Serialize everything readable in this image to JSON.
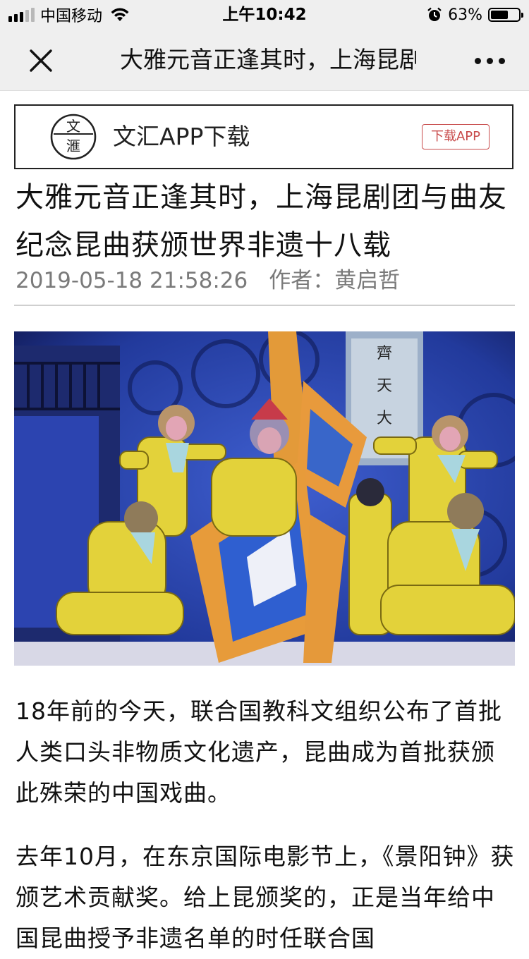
{
  "status_bar": {
    "carrier": "中国移动",
    "time": "上午10:42",
    "battery_percent": "63%",
    "battery_level": 0.63,
    "icons": [
      "signal-icon",
      "wifi-icon",
      "alarm-icon",
      "battery-icon"
    ]
  },
  "nav": {
    "title": "大雅元音正逢其时，上海昆剧",
    "close_icon": "close-icon",
    "more_icon": "more-icon"
  },
  "banner": {
    "logo_text": "文滙",
    "text": "文汇APP下载",
    "button": "下载APP",
    "accent_color": "#c84b4b"
  },
  "article": {
    "headline": "大雅元音正逢其时，上海昆剧团与曲友纪念昆曲获颁世界非遗十八载",
    "date": "2019-05-18 21:58:26",
    "author_label": "作者：",
    "author": "黄启哲",
    "banner_text": "齊天大",
    "paragraphs": [
      "18年前的今天，联合国教科文组织公布了首批人类口头非物质文化遗产，昆曲成为首批获颁此殊荣的中国戏曲。",
      "去年10月，在东京国际电影节上，《景阳钟》获颁艺术贡献奖。给上昆颁奖的，正是当年给中国昆曲授予非遗名单的时任联合国"
    ]
  }
}
